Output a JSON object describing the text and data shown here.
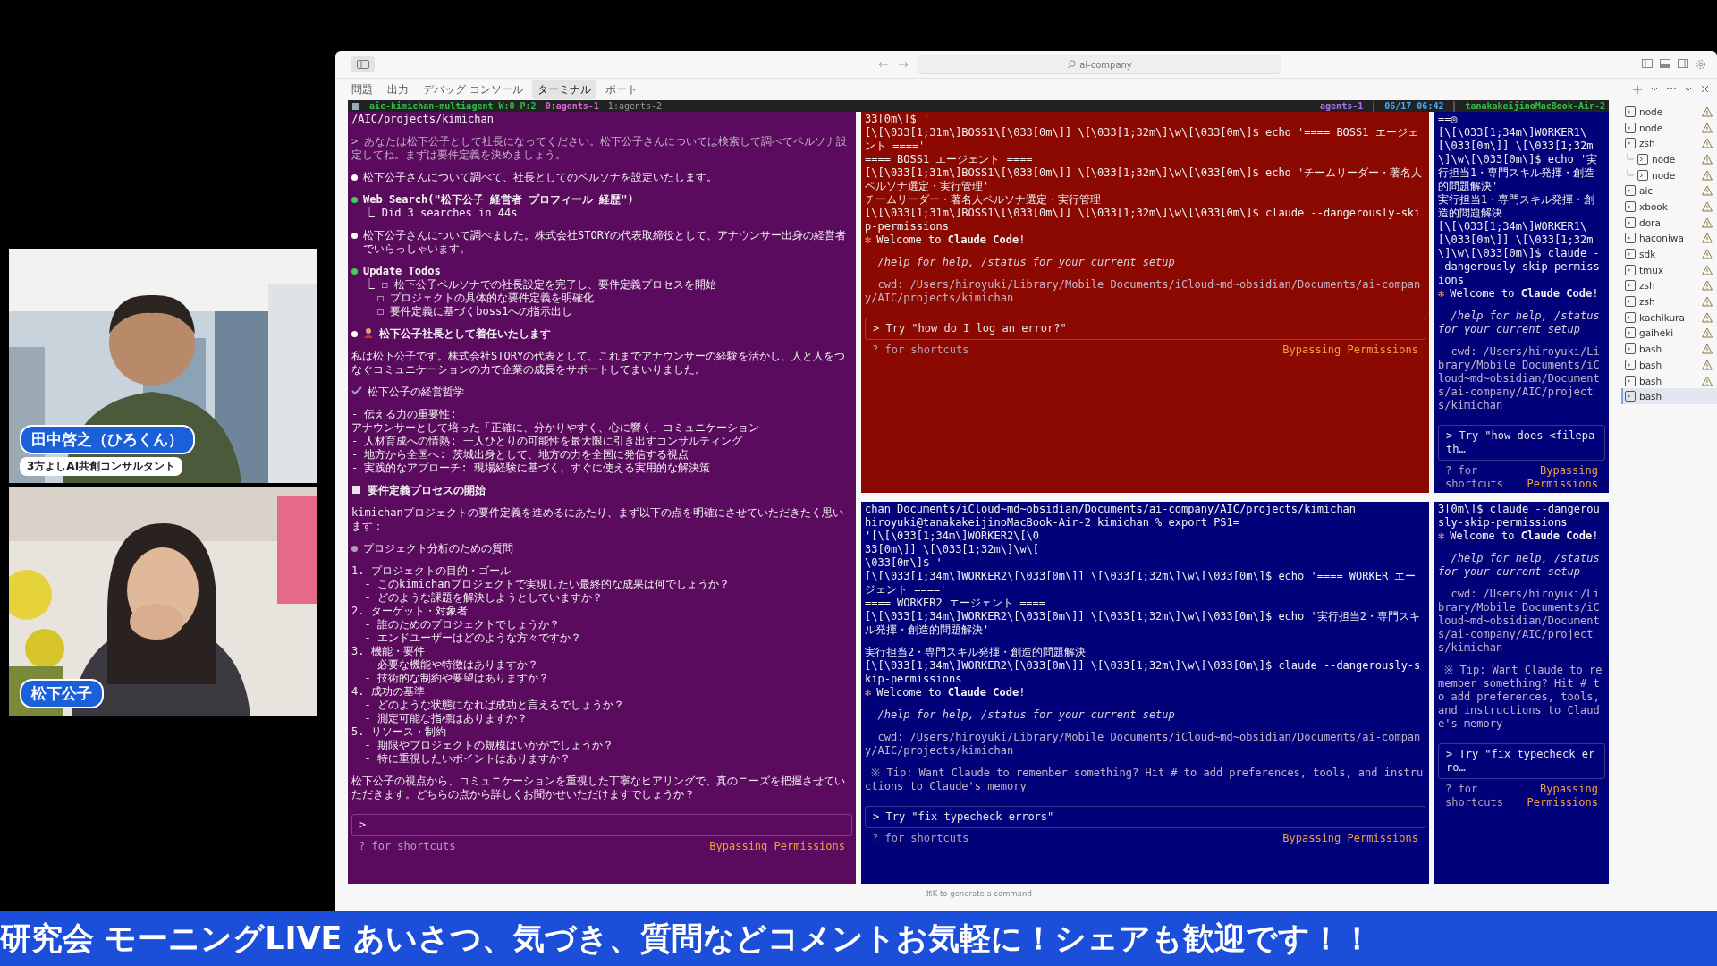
{
  "window": {
    "command_center": "ai-company"
  },
  "panel_tabs": [
    {
      "label": "問題",
      "selected": false
    },
    {
      "label": "出力",
      "selected": false
    },
    {
      "label": "デバッグ コンソール",
      "selected": false
    },
    {
      "label": "ターミナル",
      "selected": true
    },
    {
      "label": "ポート",
      "selected": false
    }
  ],
  "tmux_status": {
    "session": "aic-kimichan-multiagent W:0 P:2",
    "windows": [
      {
        "label": "0:agents-1",
        "selected": true
      },
      {
        "label": "1:agents-2",
        "selected": false
      }
    ],
    "right": [
      "agents-1",
      "06/17 06:42",
      "tanakakeijinoMacBook-Air-2"
    ]
  },
  "panes": [
    {
      "color": "#5b0b5e",
      "lines": [
        {
          "kind": "plain",
          "text": "/AIC/projects/kimichan"
        },
        {
          "kind": "dim",
          "space": true,
          "text": "> あなたは松下公子として社長になってください。松下公子さんについては検索して調べてペルソナ設定してね。まずは要件定義を決めましょう。"
        },
        {
          "kind": "bullet",
          "space": true,
          "text": "松下公子さんについて調べて、社長としてのペルソナを設定いたします。"
        },
        {
          "kind": "tool",
          "space": true,
          "text": "Web Search(\"松下公子 経営者 プロフィール 経歴\")"
        },
        {
          "kind": "plain",
          "text": "  ⎿ Did 3 searches in 44s"
        },
        {
          "kind": "bullet",
          "space": true,
          "text": "松下公子さんについて調べました。株式会社STORYの代表取締役として、アナウンサー出身の経営者でいらっしゃいます。"
        },
        {
          "kind": "tool",
          "space": true,
          "text": "Update Todos"
        },
        {
          "kind": "plain",
          "text": "  ⎿ ☐ 松下公子ペルソナでの社長設定を完了し、要件定義プロセスを開始"
        },
        {
          "kind": "plain",
          "text": "    ☐ プロジェクトの具体的な要件定義を明確化"
        },
        {
          "kind": "plain",
          "text": "    ☐ 要件定義に基づくboss1への指示出し"
        },
        {
          "kind": "person",
          "space": true,
          "text": "松下公子社長として着任いたします"
        },
        {
          "kind": "plain",
          "space": true,
          "text": "私は松下公子です。株式会社STORYの代表として、これまでアナウンサーの経験を活かし、人と人をつなぐコミュニケーションの力で企業の成長をサポートしてまいりました。"
        },
        {
          "kind": "dim_check",
          "space": true,
          "text": "松下公子の経営哲学"
        },
        {
          "kind": "plain",
          "space": true,
          "text": "- 伝える力の重要性:"
        },
        {
          "kind": "plain",
          "text": "アナウンサーとして培った「正確に、分かりやすく、心に響く」コミュニケーション"
        },
        {
          "kind": "plain",
          "text": "- 人材育成への情熱: 一人ひとりの可能性を最大限に引き出すコンサルティング"
        },
        {
          "kind": "plain",
          "text": "- 地方から全国へ: 茨城出身として、地方の力を全国に発信する視点"
        },
        {
          "kind": "plain",
          "text": "- 実践的なアプローチ: 現場経験に基づく、すぐに使える実用的な解決策"
        },
        {
          "kind": "section",
          "space": true,
          "text": "要件定義プロセスの開始"
        },
        {
          "kind": "plain",
          "space": true,
          "text": "kimichanプロジェクトの要件定義を進めるにあたり、まず以下の点を明確にさせていただきたく思います："
        },
        {
          "kind": "dim_bullet",
          "space": true,
          "text": "プロジェクト分析のための質問"
        },
        {
          "kind": "plain",
          "space": true,
          "text": "1. プロジェクトの目的・ゴール"
        },
        {
          "kind": "plain",
          "text": "  - このkimichanプロジェクトで実現したい最終的な成果は何でしょうか？"
        },
        {
          "kind": "plain",
          "text": "  - どのような課題を解決しようとしていますか？"
        },
        {
          "kind": "plain",
          "text": "2. ターゲット・対象者"
        },
        {
          "kind": "plain",
          "text": "  - 誰のためのプロジェクトでしょうか？"
        },
        {
          "kind": "plain",
          "text": "  - エンドユーザーはどのような方々ですか？"
        },
        {
          "kind": "plain",
          "text": "3. 機能・要件"
        },
        {
          "kind": "plain",
          "text": "  - 必要な機能や特徴はありますか？"
        },
        {
          "kind": "plain",
          "text": "  - 技術的な制約や要望はありますか？"
        },
        {
          "kind": "plain",
          "text": "4. 成功の基準"
        },
        {
          "kind": "plain",
          "text": "  - どのような状態になれば成功と言えるでしょうか？"
        },
        {
          "kind": "plain",
          "text": "  - 測定可能な指標はありますか？"
        },
        {
          "kind": "plain",
          "text": "5. リソース・制約"
        },
        {
          "kind": "plain",
          "text": "  - 期限やプロジェクトの規模はいかがでしょうか？"
        },
        {
          "kind": "plain",
          "text": "  - 特に重視したいポイントはありますか？"
        },
        {
          "kind": "plain",
          "space": true,
          "text": "松下公子の視点から、コミュニケーションを重視した丁寧なヒアリングで、真のニーズを把握させていただきます。どちらの点から詳しくお聞かせいただけますでしょうか？"
        }
      ],
      "input": ">",
      "hint": "? for shortcuts",
      "mode": "Bypassing Permissions"
    },
    {
      "color": "#8b0900",
      "lines": [
        {
          "kind": "plain",
          "text": "33[0m\\]$ '"
        },
        {
          "kind": "plain",
          "text": "[\\[\\033[1;31m\\]BOSS1\\[\\033[0m\\]] \\[\\033[1;32m\\]\\w\\[\\033[0m\\]$ echo '==== BOSS1 エージェント ===='"
        },
        {
          "kind": "plain",
          "text": "==== BOSS1 エージェント ===="
        },
        {
          "kind": "plain",
          "text": "[\\[\\033[1;31m\\]BOSS1\\[\\033[0m\\]] \\[\\033[1;32m\\]\\w\\[\\033[0m\\]$ echo 'チームリーダー・著名人ペルソナ選定・実行管理'"
        },
        {
          "kind": "plain",
          "text": "チームリーダー・著名人ペルソナ選定・実行管理"
        },
        {
          "kind": "plain",
          "text": "[\\[\\033[1;31m\\]BOSS1\\[\\033[0m\\]] \\[\\033[1;32m\\]\\w\\[\\033[0m\\]$ claude --dangerously-skip-permissions"
        },
        {
          "kind": "welcome",
          "mark": "✻",
          "text": "Welcome to **Claude Code**!"
        },
        {
          "kind": "italic",
          "space": true,
          "text": "  /help for help, /status for your current setup"
        },
        {
          "kind": "dim",
          "space": true,
          "text": "  cwd: /Users/hiroyuki/Library/Mobile Documents/iCloud~md~obsidian/Documents/ai-company/AIC/projects/kimichan"
        }
      ],
      "input": "> Try \"how do I log an error?\"",
      "hint": "? for shortcuts",
      "mode": "Bypassing Permissions"
    },
    {
      "color": "#01017a",
      "lines": [
        {
          "kind": "plain",
          "text": "==◎"
        },
        {
          "kind": "plain",
          "text": "[\\[\\033[1;34m\\]WORKER1\\[\\033[0m\\]] \\[\\033[1;32m\\]\\w\\[\\033[0m\\]$ echo '実行担当1・専門スキル発揮・創造的問題解決'"
        },
        {
          "kind": "plain",
          "text": "実行担当1・専門スキル発揮・創造的問題解決"
        },
        {
          "kind": "plain",
          "text": "[\\[\\033[1;34m\\]WORKER1\\[\\033[0m\\]] \\[\\033[1;32m\\]\\w\\[\\033[0m\\]$ claude --dangerously-skip-permissions"
        },
        {
          "kind": "welcome",
          "mark": "✻",
          "text": "Welcome to **Claude Code**!"
        },
        {
          "kind": "italic",
          "space": true,
          "text": "  /help for help, /status for your current setup"
        },
        {
          "kind": "dim",
          "space": true,
          "text": "  cwd: /Users/hiroyuki/Library/Mobile Documents/iCloud~md~obsidian/Documents/ai-company/AIC/projects/kimichan"
        }
      ],
      "input": "> Try \"how does <filepath…",
      "hint": "? for shortcuts",
      "mode": "Bypassing Permissions"
    },
    {
      "color": "#01017a",
      "lines": [
        {
          "kind": "plain",
          "text": "chan Documents/iCloud~md~obsidian/Documents/ai-company/AIC/projects/kimichan"
        },
        {
          "kind": "plain",
          "text": "hiroyuki@tanakakeijinoMacBook-Air-2 kimichan % export PS1="
        },
        {
          "kind": "plain",
          "text": "'[\\[\\033[1;34m\\]WORKER2\\[\\0"
        },
        {
          "kind": "plain",
          "text": "33[0m\\]] \\[\\033[1;32m\\]\\w\\["
        },
        {
          "kind": "plain",
          "text": "\\033[0m\\]$ '"
        },
        {
          "kind": "plain",
          "text": "[\\[\\033[1;34m\\]WORKER2\\[\\033[0m\\]] \\[\\033[1;32m\\]\\w\\[\\033[0m\\]$ echo '==== WORKER エージェント ===='"
        },
        {
          "kind": "plain",
          "text": "==== WORKER2 エージェント ===="
        },
        {
          "kind": "plain",
          "text": "[\\[\\033[1;34m\\]WORKER2\\[\\033[0m\\]] \\[\\033[1;32m\\]\\w\\[\\033[0m\\]$ echo '実行担当2・専門スキル発揮・創造的問題解決'"
        },
        {
          "kind": "plain",
          "space": true,
          "text": "実行担当2・専門スキル発揮・創造的問題解決"
        },
        {
          "kind": "plain",
          "text": "[\\[\\033[1;34m\\]WORKER2\\[\\033[0m\\]] \\[\\033[1;32m\\]\\w\\[\\033[0m\\]$ claude --dangerously-skip-permissions"
        },
        {
          "kind": "welcome",
          "mark": "✻",
          "text": "Welcome to **Claude Code**!"
        },
        {
          "kind": "italic",
          "space": true,
          "text": "  /help for help, /status for your current setup"
        },
        {
          "kind": "dim",
          "space": true,
          "text": "  cwd: /Users/hiroyuki/Library/Mobile Documents/iCloud~md~obsidian/Documents/ai-company/AIC/projects/kimichan"
        },
        {
          "kind": "dim",
          "space": true,
          "text": " ※ Tip: Want Claude to remember something? Hit # to add preferences, tools, and instructions to Claude's memory"
        }
      ],
      "input": "> Try \"fix typecheck errors\"",
      "hint": "? for shortcuts",
      "mode": "Bypassing Permissions"
    },
    {
      "color": "#01017a",
      "lines": [
        {
          "kind": "plain",
          "text": "3[0m\\]$ claude --dangerously-skip-permissions"
        },
        {
          "kind": "welcome",
          "mark": "✻",
          "text": "Welcome to **Claude Code**!"
        },
        {
          "kind": "italic",
          "space": true,
          "text": "  /help for help, /status for your current setup"
        },
        {
          "kind": "dim",
          "space": true,
          "text": "  cwd: /Users/hiroyuki/Library/Mobile Documents/iCloud~md~obsidian/Documents/ai-company/AIC/projects/kimichan"
        },
        {
          "kind": "dim",
          "space": true,
          "text": " ※ Tip: Want Claude to remember something? Hit # to add preferences, tools, and instructions to Claude's memory"
        }
      ],
      "input": "> Try \"fix typecheck erro…",
      "hint": "? for shortcuts",
      "mode": "Bypassing Permissions"
    }
  ],
  "terminal_list": [
    {
      "label": "node",
      "warning": true,
      "selected": false
    },
    {
      "label": "node",
      "warning": true,
      "selected": false
    },
    {
      "label": "zsh",
      "warning": true,
      "selected": false,
      "children": [
        {
          "label": "node",
          "warning": true,
          "selected": false
        },
        {
          "label": "node",
          "warning": true,
          "selected": false
        }
      ]
    },
    {
      "label": "aic",
      "warning": true,
      "selected": false
    },
    {
      "label": "xbook",
      "warning": true,
      "selected": false
    },
    {
      "label": "dora",
      "warning": true,
      "selected": false
    },
    {
      "label": "haconiwa",
      "warning": true,
      "selected": false
    },
    {
      "label": "sdk",
      "warning": true,
      "selected": false
    },
    {
      "label": "tmux",
      "warning": true,
      "selected": false
    },
    {
      "label": "zsh",
      "warning": true,
      "selected": false
    },
    {
      "label": "zsh",
      "warning": true,
      "selected": false
    },
    {
      "label": "kachikura",
      "warning": true,
      "selected": false
    },
    {
      "label": "gaiheki",
      "warning": true,
      "selected": false
    },
    {
      "label": "bash",
      "warning": true,
      "selected": false
    },
    {
      "label": "bash",
      "warning": true,
      "selected": false
    },
    {
      "label": "bash",
      "warning": true,
      "selected": false
    },
    {
      "label": "bash",
      "warning": false,
      "selected": true
    }
  ],
  "hint_line": "⌘K to generate a command",
  "cameras": [
    {
      "name": "田中啓之（ひろくん）",
      "title": "3方よしAI共創コンサルタント"
    },
    {
      "name": "松下公子"
    }
  ],
  "banner": "研究会 モーニングLIVE あいさつ、気づき、質問などコメントお気軽に！シェアも歓迎です！！"
}
